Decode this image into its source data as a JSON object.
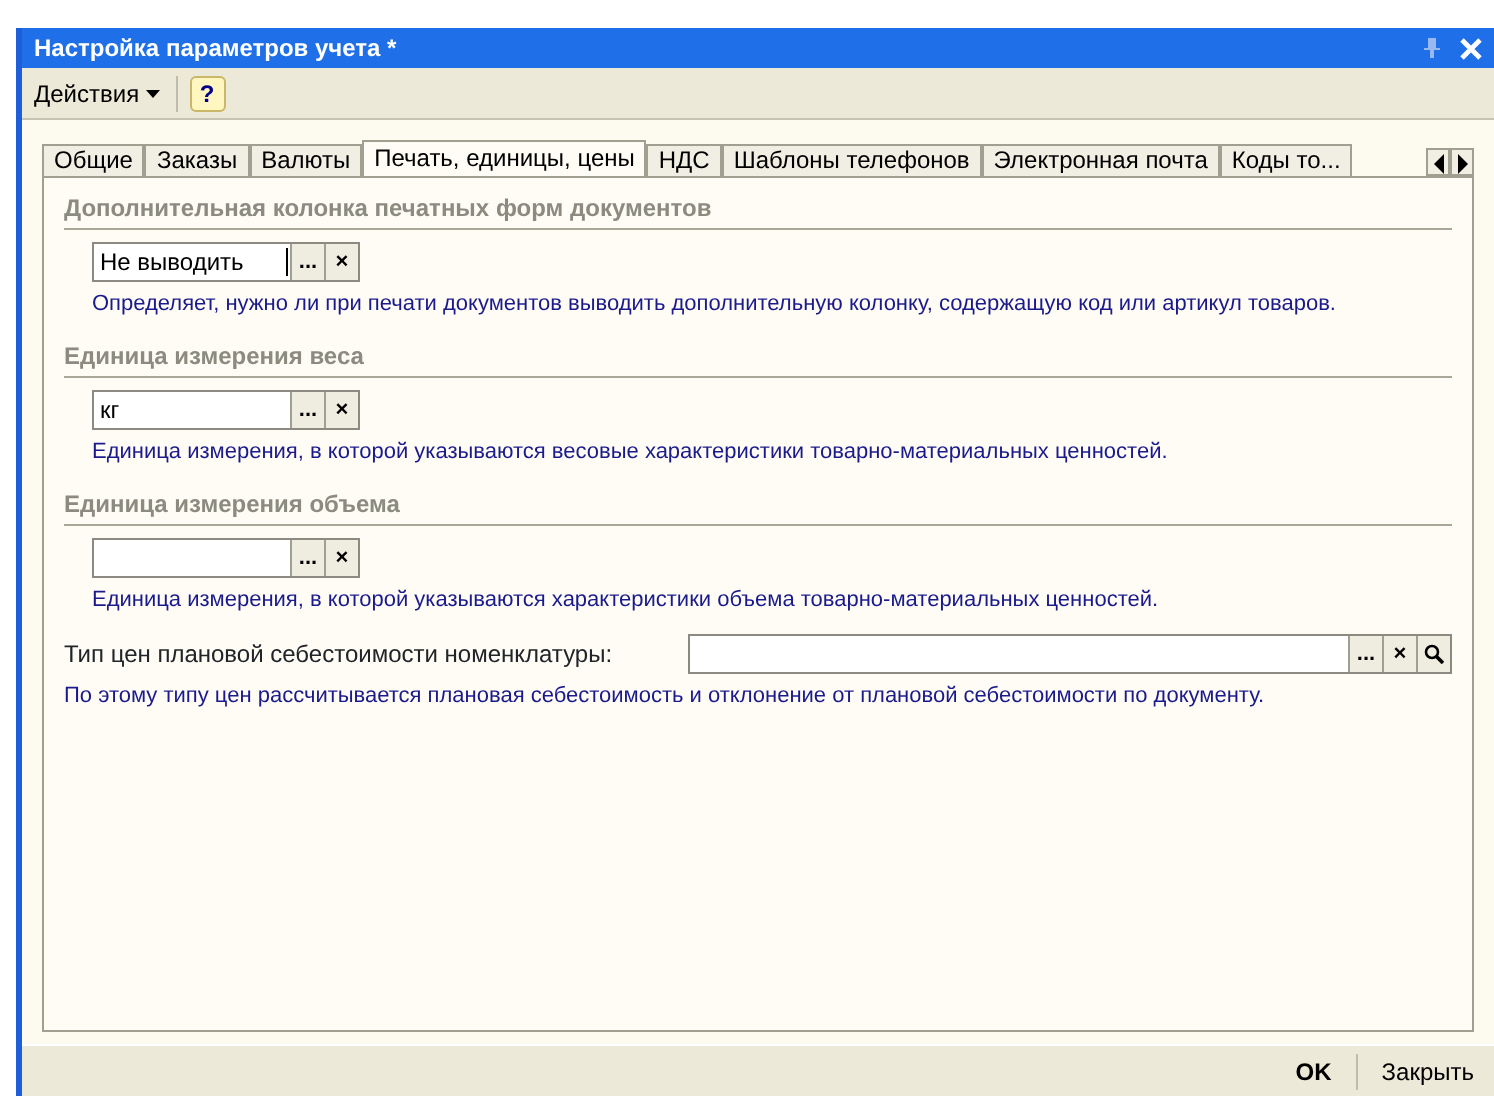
{
  "window": {
    "title": "Настройка параметров учета *"
  },
  "toolbar": {
    "actions_menu": "Действия",
    "help": "?"
  },
  "tabs": [
    {
      "label": "Общие",
      "selected": false
    },
    {
      "label": "Заказы",
      "selected": false
    },
    {
      "label": "Валюты",
      "selected": false
    },
    {
      "label": "Печать, единицы, цены",
      "selected": true
    },
    {
      "label": "НДС",
      "selected": false
    },
    {
      "label": "Шаблоны телефонов",
      "selected": false
    },
    {
      "label": "Электронная почта",
      "selected": false
    },
    {
      "label": "Коды то...",
      "selected": false
    }
  ],
  "sections": [
    {
      "kind": "group",
      "heading": "Дополнительная колонка печатных форм документов",
      "field": {
        "value": "Не выводить",
        "focused": true,
        "buttons": [
          "...",
          "×"
        ],
        "search": false
      },
      "hint": "Определяет, нужно ли при печати документов выводить дополнительную колонку, содержащую код или артикул товаров."
    },
    {
      "kind": "group",
      "heading": "Единица измерения веса",
      "field": {
        "value": "кг",
        "focused": false,
        "buttons": [
          "...",
          "×"
        ],
        "search": false
      },
      "hint": "Единица измерения, в которой указываются весовые характеристики товарно-материальных ценностей."
    },
    {
      "kind": "group",
      "heading": "Единица измерения объема",
      "field": {
        "focused": false,
        "buttons": [
          "...",
          "×"
        ],
        "search": false
      },
      "hint": "Единица измерения, в которой указываются характеристики объема товарно-материальных ценностей."
    },
    {
      "kind": "inline",
      "label": "Тип цен плановой себестоимости номенклатуры:",
      "field": {
        "focused": false,
        "buttons": [
          "...",
          "×"
        ],
        "search": true
      },
      "hint": "По этому типу цен рассчитывается плановая себестоимость и отклонение от плановой себестоимости по документу."
    }
  ],
  "buttons": [
    {
      "label": "OK",
      "default": true
    },
    {
      "label": "Закрыть",
      "default": false
    }
  ]
}
